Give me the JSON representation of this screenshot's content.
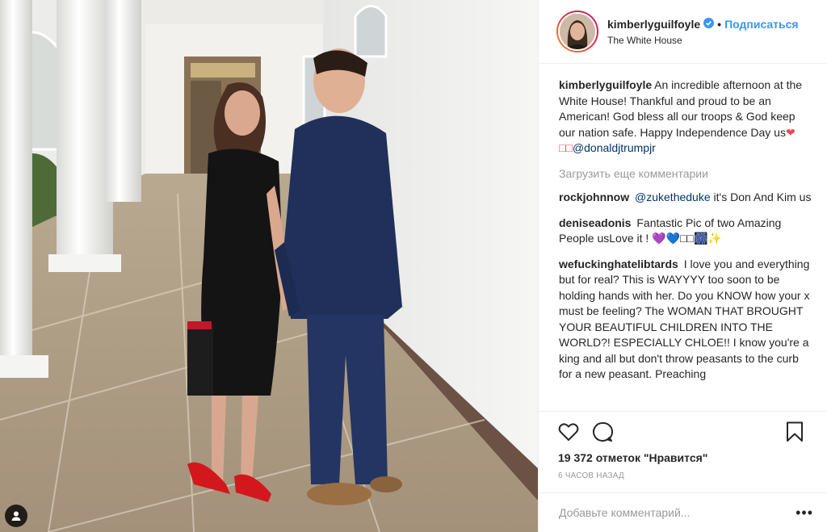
{
  "post": {
    "username": "kimberlyguilfoyle",
    "follow_label": "Подписаться",
    "dot": "•",
    "location": "The White House",
    "caption": {
      "author": "kimberlyguilfoyle",
      "text": "An incredible afternoon at the White House! Thankful and proud to be an American! God bless all our troops & God keep our nation safe. Happy Independence Day us",
      "emoji": "❤︎□□",
      "mention": "@donaldjtrumpjr"
    },
    "load_more": "Загрузить еще комментарии",
    "comments": [
      {
        "author": "rockjohnnow",
        "mention": "@zuketheduke",
        "text": " it's Don And Kim us"
      },
      {
        "author": "deniseadonis",
        "mention": "",
        "text": "Fantastic Pic of two Amazing People usLove it ! 💜💙□□🎆✨"
      },
      {
        "author": "wefuckinghatelibtards",
        "mention": "",
        "text": "I love you and everything but for real? This is WAYYYY too soon to be holding hands with her. Do you KNOW how your x must be feeling? The WOMAN THAT BROUGHT YOUR BEAUTIFUL CHILDREN INTO THE WORLD?! ESPECIALLY CHLOE!! I know you're a king and all but don't throw peasants to the curb for a new peasant. Preaching"
      }
    ],
    "likes": "19 372 отметок \"Нравится\"",
    "time": "6 часов назад",
    "add_comment_placeholder": "Добавьте комментарий...",
    "more_options": "•••"
  },
  "icons": {
    "heart": "heart-icon",
    "comment": "comment-icon",
    "bookmark": "bookmark-icon",
    "tag": "person-tag-icon",
    "verified": "verified-badge-icon"
  },
  "colors": {
    "link": "#3897f0",
    "mention": "#003569",
    "muted": "#999999",
    "text": "#262626",
    "border": "#efefef",
    "verified": "#3897f0",
    "heart_emoji": "#ed4956"
  }
}
